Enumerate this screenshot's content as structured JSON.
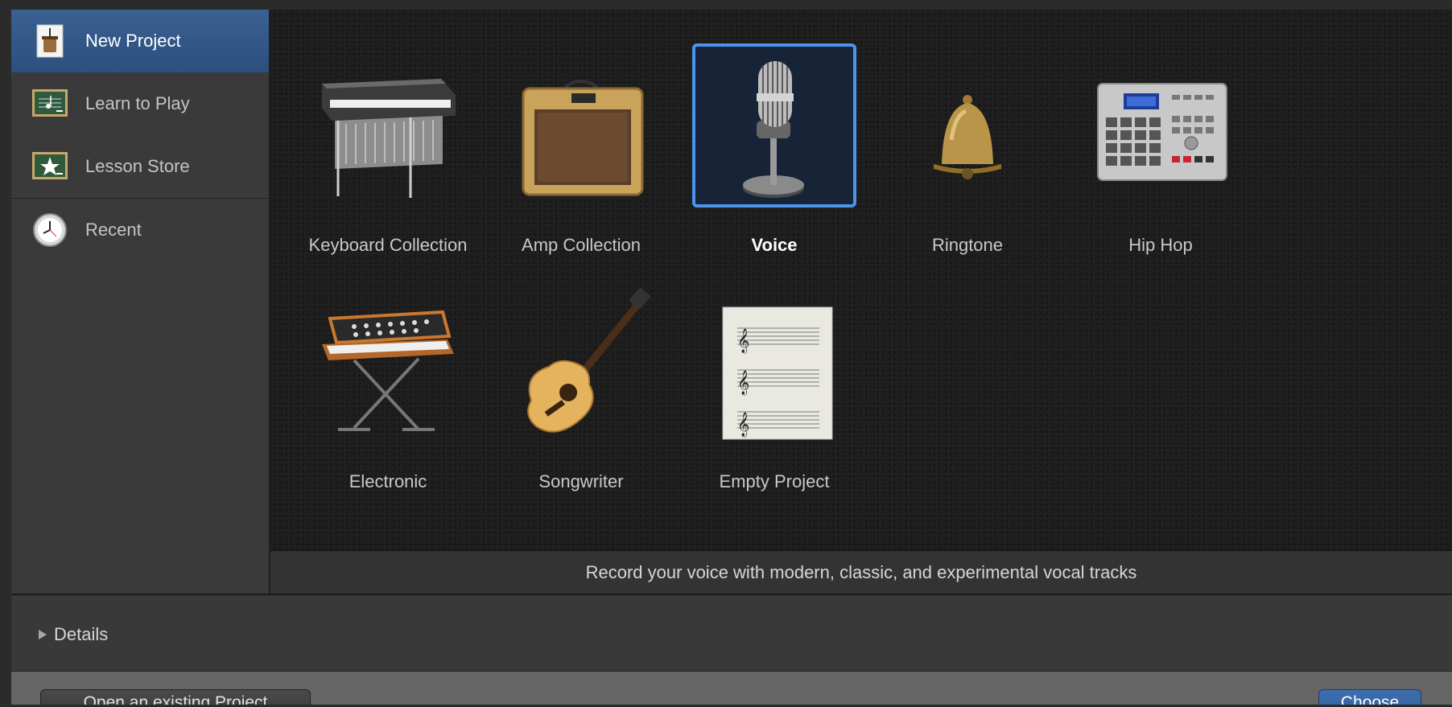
{
  "sidebar": {
    "items": [
      {
        "label": "New Project",
        "icon": "new-project-icon"
      },
      {
        "label": "Learn to Play",
        "icon": "learn-to-play-icon"
      },
      {
        "label": "Lesson Store",
        "icon": "lesson-store-icon"
      },
      {
        "label": "Recent",
        "icon": "clock-icon"
      }
    ]
  },
  "templates": [
    {
      "label": "Keyboard Collection",
      "icon": "electric-piano-icon"
    },
    {
      "label": "Amp Collection",
      "icon": "guitar-amp-icon"
    },
    {
      "label": "Voice",
      "icon": "microphone-icon"
    },
    {
      "label": "Ringtone",
      "icon": "bell-icon"
    },
    {
      "label": "Hip Hop",
      "icon": "drum-machine-icon"
    },
    {
      "label": "Electronic",
      "icon": "synthesizer-icon"
    },
    {
      "label": "Songwriter",
      "icon": "acoustic-guitar-icon"
    },
    {
      "label": "Empty Project",
      "icon": "sheet-music-icon"
    }
  ],
  "selected_template": "Voice",
  "description": "Record your voice with modern, classic, and experimental vocal tracks",
  "details_label": "Details",
  "footer": {
    "open_label": "Open an existing Project",
    "choose_label": "Choose"
  },
  "colors": {
    "selection": "#4c94ec",
    "active_sidebar": "#3a6192"
  }
}
